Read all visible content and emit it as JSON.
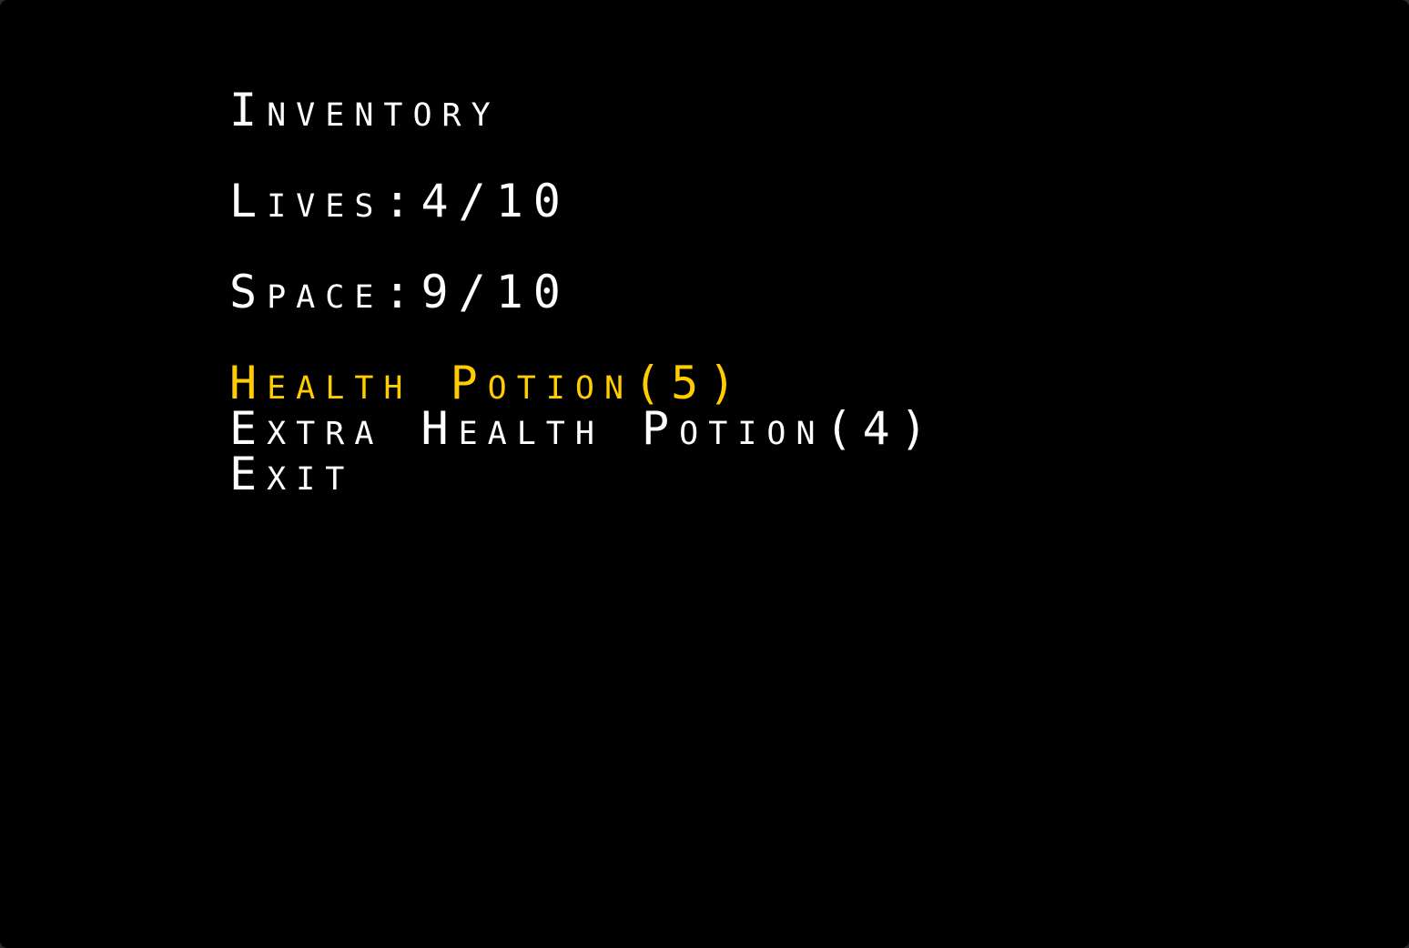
{
  "inventory": {
    "title": "Inventory",
    "lives": "Lives:4/10",
    "space": "Space:9/10",
    "menu": [
      {
        "label": "Health Potion(5)",
        "selected": true
      },
      {
        "label": "Extra Health Potion(4)",
        "selected": false
      },
      {
        "label": "Exit",
        "selected": false
      }
    ]
  },
  "colors": {
    "background": "#000000",
    "text": "#ffffff",
    "highlight": "#ffcc00"
  }
}
